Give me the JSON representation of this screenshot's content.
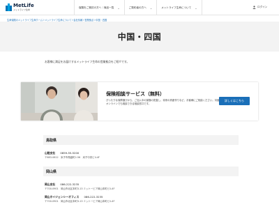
{
  "header": {
    "logo": {
      "name": "MetLife",
      "sub": "メットライフ生命"
    },
    "nav": [
      {
        "label": "保険をご検討の方へ｜商品一覧"
      },
      {
        "label": "ご契約者の方へ"
      },
      {
        "label": "メットライフ生命について"
      }
    ],
    "login_label": "ログイン"
  },
  "breadcrumb": "生命保険のメットライフ生命ホーム＞メットライフ生命について＞会社情報＞営業拠点＞中国・四国",
  "page_title": "中国・四国",
  "intro": "お客様に満足をお届けするメットライフ生命の営業拠点をご紹介です。",
  "card": {
    "title": "保険相談サービス（無料）",
    "text": "ぴったりな保障選びから、ご加入中の保険の見直し、将来の資産作りなど、お客様にご相談ください。対面でもオンラインでも相談できる相談窓口です。",
    "button_label": "詳しくはこちら"
  },
  "sections": [
    {
      "title": "鳥取県",
      "offices": [
        {
          "name": "山陰支社",
          "phone": "0859-55-5200",
          "address": "〒683-0812　米子市角盤町2-56　米子中央ビル4F"
        }
      ]
    },
    {
      "title": "岡山県",
      "offices": [
        {
          "name": "岡山支社",
          "phone": "086-222-3235",
          "address": "〒700-0901　岡山市北区本町3-13 ミットービア岡山本町ビル4F"
        },
        {
          "name": "岡山ホイジェンシーオフィス",
          "phone": "086-222-3235",
          "address": "〒700-0901　岡山市北区本町3-13 ミットービア岡山本町ビル4F"
        }
      ]
    }
  ],
  "colors": {
    "brand": "#1a6fb8",
    "hero_bg": "#f3f3f3"
  }
}
